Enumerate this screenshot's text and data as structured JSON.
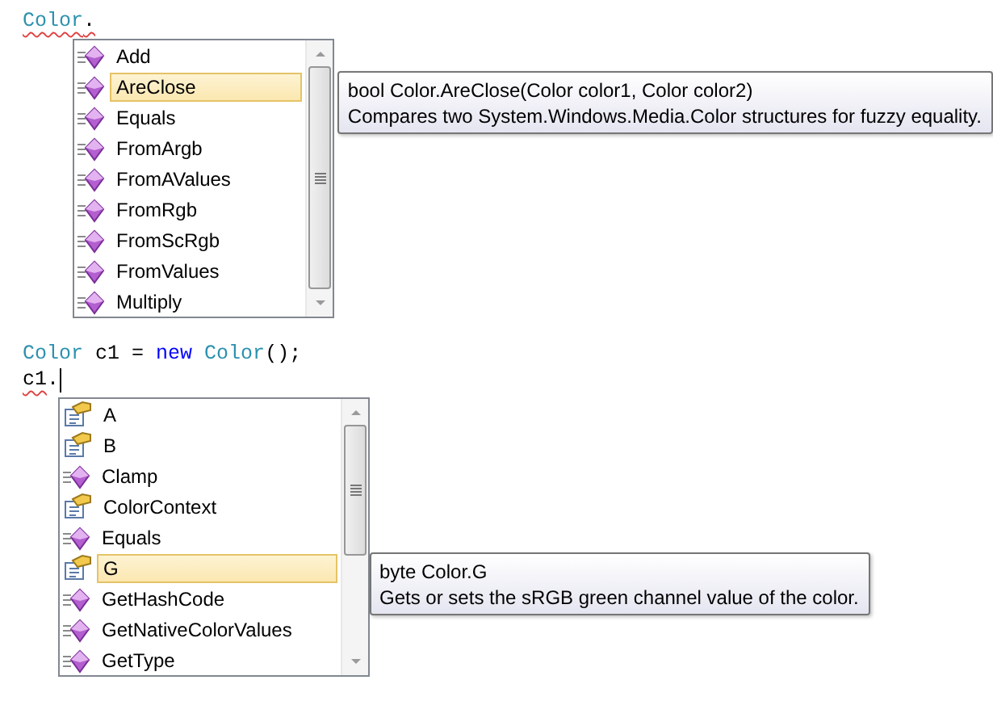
{
  "editors": [
    {
      "code_lines": [
        [
          {
            "text": "Color",
            "kind": "type",
            "error": true
          },
          {
            "text": ".",
            "kind": "plain",
            "error": true
          }
        ]
      ],
      "completion": {
        "items": [
          {
            "label": "Add",
            "kind": "method",
            "selected": false
          },
          {
            "label": "AreClose",
            "kind": "method",
            "selected": true
          },
          {
            "label": "Equals",
            "kind": "method",
            "selected": false
          },
          {
            "label": "FromArgb",
            "kind": "method",
            "selected": false
          },
          {
            "label": "FromAValues",
            "kind": "method",
            "selected": false
          },
          {
            "label": "FromRgb",
            "kind": "method",
            "selected": false
          },
          {
            "label": "FromScRgb",
            "kind": "method",
            "selected": false
          },
          {
            "label": "FromValues",
            "kind": "method",
            "selected": false
          },
          {
            "label": "Multiply",
            "kind": "method",
            "selected": false
          }
        ],
        "tooltip": {
          "signature": "bool Color.AreClose(Color color1, Color color2)",
          "description": "Compares two System.Windows.Media.Color structures for fuzzy equality."
        }
      }
    },
    {
      "code_lines": [
        [
          {
            "text": "Color",
            "kind": "type",
            "error": false
          },
          {
            "text": " c1 = ",
            "kind": "plain",
            "error": false
          },
          {
            "text": "new",
            "kind": "keyword",
            "error": false
          },
          {
            "text": " Color",
            "kind": "type",
            "error": false
          },
          {
            "text": "();",
            "kind": "plain",
            "error": false
          }
        ],
        [
          {
            "text": "c1",
            "kind": "plain",
            "error": true
          },
          {
            "text": ".",
            "kind": "plain",
            "error": false
          }
        ]
      ],
      "completion": {
        "items": [
          {
            "label": "A",
            "kind": "property",
            "selected": false
          },
          {
            "label": "B",
            "kind": "property",
            "selected": false
          },
          {
            "label": "Clamp",
            "kind": "method",
            "selected": false
          },
          {
            "label": "ColorContext",
            "kind": "property",
            "selected": false
          },
          {
            "label": "Equals",
            "kind": "method",
            "selected": false
          },
          {
            "label": "G",
            "kind": "property",
            "selected": true
          },
          {
            "label": "GetHashCode",
            "kind": "method",
            "selected": false
          },
          {
            "label": "GetNativeColorValues",
            "kind": "method",
            "selected": false
          },
          {
            "label": "GetType",
            "kind": "method",
            "selected": false
          }
        ],
        "tooltip": {
          "signature": "byte Color.G",
          "description": "Gets or sets the sRGB green channel value of the color."
        }
      }
    }
  ]
}
